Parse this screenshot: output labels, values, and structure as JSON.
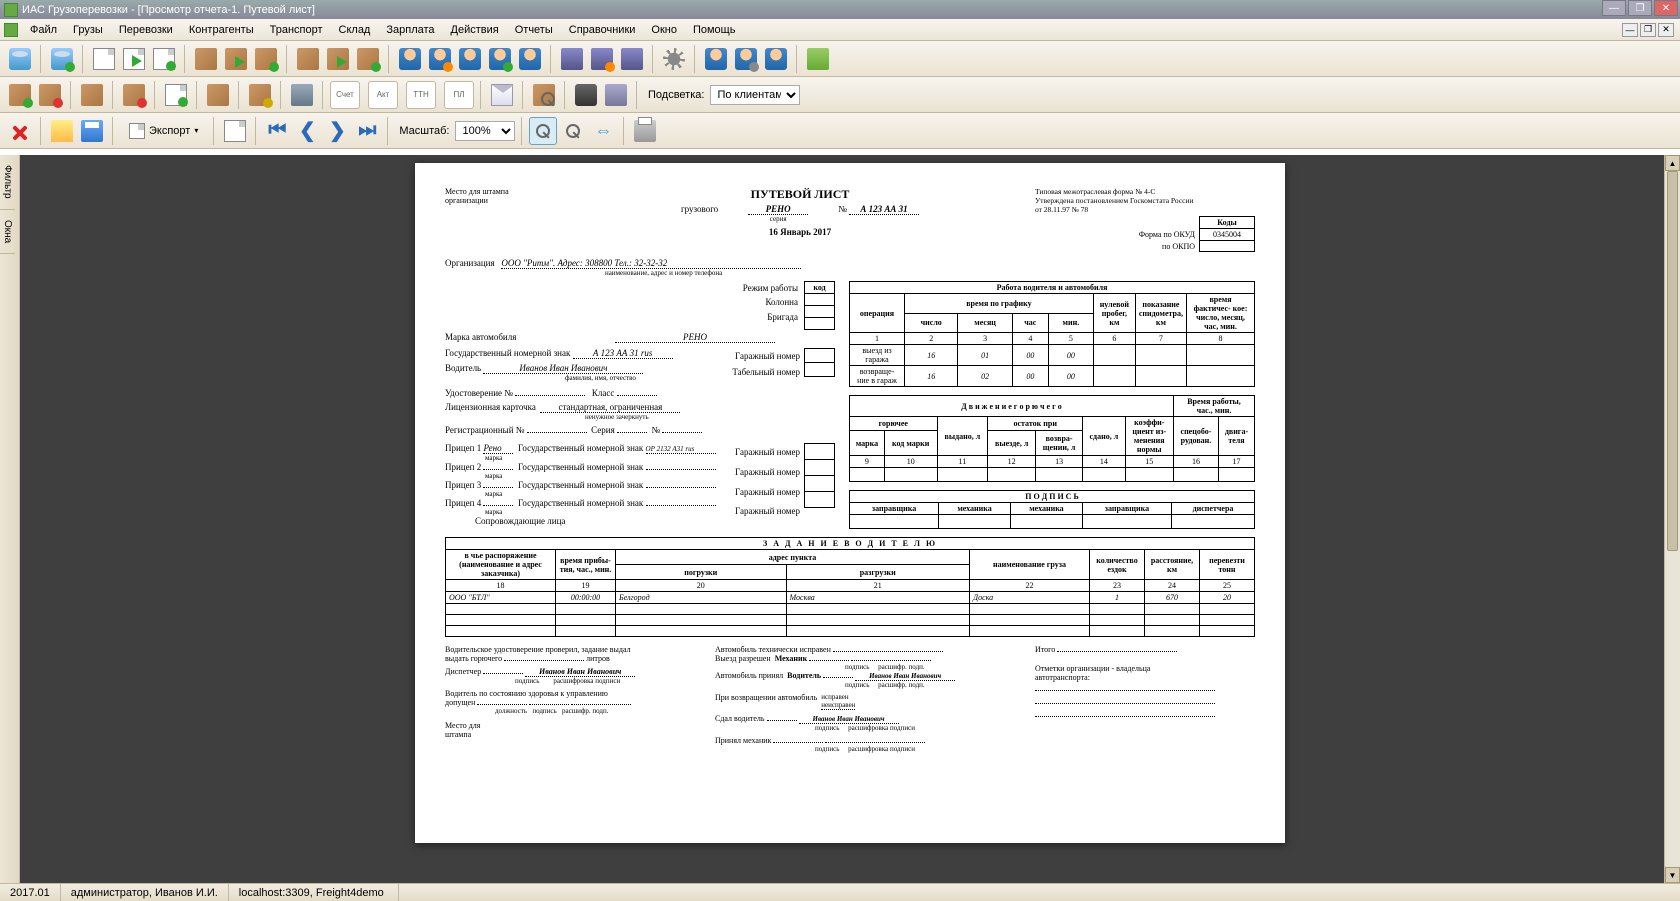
{
  "title": "ИАС Грузоперевозки - [Просмотр отчета-1. Путевой лист]",
  "menu": {
    "items": [
      "Файл",
      "Грузы",
      "Перевозки",
      "Контрагенты",
      "Транспорт",
      "Склад",
      "Зарплата",
      "Действия",
      "Отчеты",
      "Справочники",
      "Окно",
      "Помощь"
    ]
  },
  "toolbar3": {
    "export_label": "Экспорт",
    "scale_label": "Масштаб:",
    "scale_value": "100%"
  },
  "toolbar2": {
    "highlight_label": "Подсветка:",
    "highlight_value": "По клиентам",
    "small_labels": [
      "Счет",
      "Акт",
      "ТТН",
      "ПЛ"
    ]
  },
  "sidebar": {
    "tabs": [
      "Фильтр",
      "Окна"
    ]
  },
  "status": {
    "version": "2017.01",
    "user": "администратор, Иванов И.И.",
    "server": "localhost:3309, Freight4demo"
  },
  "doc": {
    "stamp_place": "Место для штампа\nорганизации",
    "title": "ПУТЕВОЙ ЛИСТ",
    "subtitle_cargo": "грузового",
    "vehicle_brand_inline": "РЕНО",
    "series_label": "серия",
    "number_label": "№",
    "number_value": "А 123 АА 31",
    "date": "16 Январь 2017",
    "form_note": "Типовая межотраслевая форма № 4-С\nУтверждена постановлением Госкомстата России\nот 28.11.97 № 78",
    "codes_header": "Коды",
    "okud_label": "Форма по ОКУД",
    "okud_value": "0345004",
    "okpo_label": "по ОКПО",
    "okpo_value": "",
    "org_label": "Организация",
    "org_value": "ООО \"Ритм\". Адрес: 308800 Тел.: 32-32-32",
    "org_sub": "наименование, адрес и номер телефона",
    "left": {
      "mode_label": "Режим работы",
      "column_label": "Колонна",
      "brigade_label": "Бригада",
      "code_label": "код",
      "car_brand_label": "Марка автомобиля",
      "car_brand_value": "РЕНО",
      "gos_num_label": "Государственный номерной знак",
      "gos_num_value": "А 123 АА 31 rus",
      "garage_num_label": "Гаражный номер",
      "driver_label": "Водитель",
      "driver_value": "Иванов Иван Иванович",
      "driver_sub": "фамилия, имя, отчество",
      "tab_num_label": "Табельный номер",
      "cert_label": "Удостоверение №",
      "class_label": "Класс",
      "lic_label": "Лицензионная карточка",
      "lic_value": "стандартная, ограниченная",
      "lic_sub": "ненужное зачеркнуть",
      "reg_label": "Регистрационный №",
      "series_inline": "Серия",
      "no_inline": "№",
      "trailer_label": "Прицеп",
      "trailer1_value": "Рено",
      "trailer1_gos": "ОР 2132 А31 rus",
      "brand_sub": "марка",
      "escort_label": "Сопровождающие лица"
    },
    "work_table": {
      "title": "Работа водителя и автомобиля",
      "cols": {
        "operation": "операция",
        "schedule": "время по графику",
        "number": "число",
        "month": "месяц",
        "hour": "час",
        "min": "мин.",
        "zero_run": "нулевой пробег, км",
        "odometer": "показание спидометра, км",
        "actual_time": "время фактичес- кое:\nчисло, месяц, час, мин."
      },
      "col_nums": [
        "1",
        "2",
        "3",
        "4",
        "5",
        "6",
        "7",
        "8"
      ],
      "rows": [
        {
          "op": "выезд из гаража",
          "n": "16",
          "m": "01",
          "h": "00",
          "mi": "00",
          "zr": "",
          "od": "",
          "at": ""
        },
        {
          "op": "возвраще-\nние в гараж",
          "n": "16",
          "m": "02",
          "h": "00",
          "mi": "00",
          "zr": "",
          "od": "",
          "at": ""
        }
      ]
    },
    "fuel_table": {
      "title": "Д в и ж е н и е   г о р ю ч е г о",
      "worktime_title": "Время работы,\nчас., мин.",
      "cols": {
        "fuel": "горючее",
        "brand": "марка",
        "code": "код марки",
        "issued": "выдано, л",
        "remain": "остаток при",
        "out": "выезде, л",
        "ret": "возвра-\nщении, л",
        "added": "сдано, л",
        "coef": "коэффи-\nциент из-\nменения\nнормы",
        "spec": "спецобо-\nрудован.",
        "engine": "двига-\nтеля"
      },
      "col_nums": [
        "9",
        "10",
        "11",
        "12",
        "13",
        "14",
        "15",
        "16",
        "17"
      ]
    },
    "sign_table": {
      "title": "П О Д П И С Ь",
      "cols": [
        "заправщика",
        "механика",
        "механика",
        "заправщика",
        "диспетчера"
      ]
    },
    "task": {
      "title": "З А Д А Н И Е   В О Д И Т Е Л Ю",
      "cols": {
        "disposal": "в чье распоряжение\n(наименование и адрес\nзаказчика)",
        "arrival": "время прибы-\nтия, час., мин.",
        "address": "адрес пункта",
        "loading": "погрузки",
        "unloading": "разгрузки",
        "cargo": "наименование груза",
        "trips": "количество\nездок",
        "dist": "расстояние,\nкм",
        "tons": "перевезти\nтонн"
      },
      "col_nums": [
        "18",
        "19",
        "20",
        "21",
        "22",
        "23",
        "24",
        "25"
      ],
      "row1": {
        "customer": "ООО \"БТЛ\"",
        "time": "00:00:00",
        "load": "Белгород",
        "unload": "Москва",
        "cargo": "Доска",
        "trips": "1",
        "dist": "670",
        "tons": "20"
      }
    },
    "footer": {
      "cert_check": "Водительское удостоверение проверил, задание выдал",
      "fuel_issue": "выдать горючего",
      "liters": "литров",
      "dispatcher": "Диспетчер",
      "dispatcher_name": "Иванов Иван Иванович",
      "sig_sub": "подпись",
      "decode_sub": "расшифровка подписи",
      "decode_sub2": "расшифр. подп.",
      "health": "Водитель по состоянию здоровья к управлению",
      "allowed": "допущен",
      "position": "должность",
      "stamp": "Место для\nштампа",
      "car_ok": "Автомобиль технически исправен",
      "exit_allowed": "Выезд разрешен",
      "mechanic": "Механик",
      "car_accepted": "Автомобиль принял",
      "driver_role": "Водитель",
      "driver_name": "Иванов Иван Иванович",
      "on_return": "При возвращении автомобиль",
      "ok_notok": "исправен\nнеисправен",
      "handed": "Сдал водитель",
      "handed_name": "Иванов Иван Иванович",
      "accepted_mech": "Принял механик",
      "total": "Итого",
      "org_marks": "Отметки организации - владельца\nавтотранспорта:"
    }
  }
}
